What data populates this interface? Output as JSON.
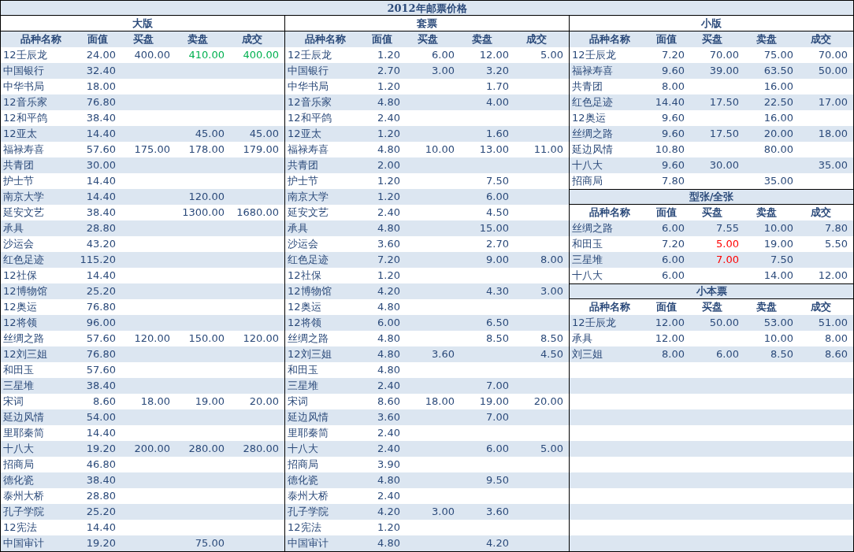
{
  "title": "2012年邮票价格",
  "panels": [
    {
      "sections": [
        {
          "title": "大版",
          "columns": [
            "品种名称",
            "面值",
            "买盘",
            "卖盘",
            "成交"
          ],
          "rows": [
            {
              "name": "12壬辰龙",
              "face_value": "24.00",
              "bid": "400.00",
              "ask": {
                "text": "410.00",
                "color": "#00b050"
              },
              "deal": {
                "text": "400.00",
                "color": "#00b050"
              }
            },
            {
              "name": "中国银行",
              "face_value": "32.40"
            },
            {
              "name": "中华书局",
              "face_value": "18.00"
            },
            {
              "name": "12音乐家",
              "face_value": "76.80"
            },
            {
              "name": "12和平鸽",
              "face_value": "38.40"
            },
            {
              "name": "12亚太",
              "face_value": "14.40",
              "ask": "45.00",
              "deal": "45.00"
            },
            {
              "name": "福禄寿喜",
              "face_value": "57.60",
              "bid": "175.00",
              "ask": "178.00",
              "deal": "179.00"
            },
            {
              "name": "共青团",
              "face_value": "30.00"
            },
            {
              "name": "护士节",
              "face_value": "14.40"
            },
            {
              "name": "南京大学",
              "face_value": "14.40",
              "ask": "120.00"
            },
            {
              "name": "延安文艺",
              "face_value": "38.40",
              "ask": "1300.00",
              "deal": "1680.00"
            },
            {
              "name": "承具",
              "face_value": "28.80"
            },
            {
              "name": "沙运会",
              "face_value": "43.20"
            },
            {
              "name": "红色足迹",
              "face_value": "115.20"
            },
            {
              "name": "12社保",
              "face_value": "14.40"
            },
            {
              "name": "12博物馆",
              "face_value": "25.20"
            },
            {
              "name": "12奥运",
              "face_value": "76.80"
            },
            {
              "name": "12将领",
              "face_value": "96.00"
            },
            {
              "name": "丝绸之路",
              "face_value": "57.60",
              "bid": "120.00",
              "ask": "150.00",
              "deal": "120.00"
            },
            {
              "name": "12刘三姐",
              "face_value": "76.80"
            },
            {
              "name": "和田玉",
              "face_value": "57.60"
            },
            {
              "name": "三星堆",
              "face_value": "38.40"
            },
            {
              "name": "宋词",
              "face_value": "8.60",
              "bid": "18.00",
              "ask": "19.00",
              "deal": "20.00"
            },
            {
              "name": "延边风情",
              "face_value": "54.00"
            },
            {
              "name": "里耶秦简",
              "face_value": "14.40"
            },
            {
              "name": "十八大",
              "face_value": "19.20",
              "bid": "200.00",
              "ask": "280.00",
              "deal": "280.00"
            },
            {
              "name": "招商局",
              "face_value": "46.80"
            },
            {
              "name": "德化瓷",
              "face_value": "38.40"
            },
            {
              "name": "泰州大桥",
              "face_value": "28.80"
            },
            {
              "name": "孔子学院",
              "face_value": "25.20"
            },
            {
              "name": "12宪法",
              "face_value": "14.40"
            },
            {
              "name": "中国审计",
              "face_value": "19.20",
              "ask": "75.00"
            }
          ]
        }
      ]
    },
    {
      "sections": [
        {
          "title": "套票",
          "columns": [
            "品种名称",
            "面值",
            "买盘",
            "卖盘",
            "成交"
          ],
          "rows": [
            {
              "name": "12壬辰龙",
              "face_value": "1.20",
              "bid": "6.00",
              "ask": "12.00",
              "deal": "5.00"
            },
            {
              "name": "中国银行",
              "face_value": "2.70",
              "bid": "3.00",
              "ask": "3.20"
            },
            {
              "name": "中华书局",
              "face_value": "1.20",
              "ask": "1.70"
            },
            {
              "name": "12音乐家",
              "face_value": "4.80",
              "ask": "4.00"
            },
            {
              "name": "12和平鸽",
              "face_value": "2.40"
            },
            {
              "name": "12亚太",
              "face_value": "1.20",
              "ask": "1.60"
            },
            {
              "name": "福禄寿喜",
              "face_value": "4.80",
              "bid": "10.00",
              "ask": "13.00",
              "deal": "11.00"
            },
            {
              "name": "共青团",
              "face_value": "2.00"
            },
            {
              "name": "护士节",
              "face_value": "1.20",
              "ask": "7.50"
            },
            {
              "name": "南京大学",
              "face_value": "1.20",
              "ask": "6.00"
            },
            {
              "name": "延安文艺",
              "face_value": "2.40",
              "ask": "4.50"
            },
            {
              "name": "承具",
              "face_value": "4.80",
              "ask": "15.00"
            },
            {
              "name": "沙运会",
              "face_value": "3.60",
              "ask": "2.70"
            },
            {
              "name": "红色足迹",
              "face_value": "7.20",
              "ask": "9.00",
              "deal": "8.00"
            },
            {
              "name": "12社保",
              "face_value": "1.20"
            },
            {
              "name": "12博物馆",
              "face_value": "4.20",
              "ask": "4.30",
              "deal": "3.00"
            },
            {
              "name": "12奥运",
              "face_value": "4.80"
            },
            {
              "name": "12将领",
              "face_value": "6.00",
              "ask": "6.50"
            },
            {
              "name": "丝绸之路",
              "face_value": "4.80",
              "ask": "8.50",
              "deal": "8.50"
            },
            {
              "name": "12刘三姐",
              "face_value": "4.80",
              "bid": "3.60",
              "deal": "4.50"
            },
            {
              "name": "和田玉",
              "face_value": "4.80"
            },
            {
              "name": "三星堆",
              "face_value": "2.40",
              "ask": "7.00"
            },
            {
              "name": "宋词",
              "face_value": "8.60",
              "bid": "18.00",
              "ask": "19.00",
              "deal": "20.00"
            },
            {
              "name": "延边风情",
              "face_value": "3.60",
              "ask": "7.00"
            },
            {
              "name": "里耶秦简",
              "face_value": "2.40"
            },
            {
              "name": "十八大",
              "face_value": "2.40",
              "ask": "6.00",
              "deal": "5.00"
            },
            {
              "name": "招商局",
              "face_value": "3.90"
            },
            {
              "name": "德化瓷",
              "face_value": "4.80",
              "ask": "9.50"
            },
            {
              "name": "泰州大桥",
              "face_value": "2.40"
            },
            {
              "name": "孔子学院",
              "face_value": "4.20",
              "bid": "3.00",
              "ask": "3.60"
            },
            {
              "name": "12宪法",
              "face_value": "1.20"
            },
            {
              "name": "中国审计",
              "face_value": "4.80",
              "ask": "4.20"
            }
          ]
        }
      ]
    },
    {
      "sections": [
        {
          "title": "小版",
          "columns": [
            "品种名称",
            "面值",
            "买盘",
            "卖盘",
            "成交"
          ],
          "rows": [
            {
              "name": "12壬辰龙",
              "face_value": "7.20",
              "bid": "70.00",
              "ask": "75.00",
              "deal": "70.00"
            },
            {
              "name": "福禄寿喜",
              "face_value": "9.60",
              "bid": "39.00",
              "ask": "63.50",
              "deal": "50.00"
            },
            {
              "name": "共青团",
              "face_value": "8.00",
              "ask": "16.00"
            },
            {
              "name": "红色足迹",
              "face_value": "14.40",
              "bid": "17.50",
              "ask": "22.50",
              "deal": "17.00"
            },
            {
              "name": "12奥运",
              "face_value": "9.60",
              "ask": "16.00"
            },
            {
              "name": "丝绸之路",
              "face_value": "9.60",
              "bid": "17.50",
              "ask": "20.00",
              "deal": "18.00"
            },
            {
              "name": "延边风情",
              "face_value": "10.80",
              "ask": "80.00"
            },
            {
              "name": "十八大",
              "face_value": "9.60",
              "bid": "30.00",
              "deal": "35.00"
            },
            {
              "name": "招商局",
              "face_value": "7.80",
              "ask": "35.00"
            }
          ]
        },
        {
          "title": "型张/全张",
          "columns": [
            "品种名称",
            "面值",
            "买盘",
            "卖盘",
            "成交"
          ],
          "rows": [
            {
              "name": "丝绸之路",
              "face_value": "6.00",
              "bid": "7.55",
              "ask": "10.00",
              "deal": "7.80"
            },
            {
              "name": "和田玉",
              "face_value": "7.20",
              "bid": {
                "text": "5.00",
                "color": "#ff0000"
              },
              "ask": "19.00",
              "deal": "5.50"
            },
            {
              "name": "三星堆",
              "face_value": "6.00",
              "bid": {
                "text": "7.00",
                "color": "#ff0000"
              },
              "ask": "7.50"
            },
            {
              "name": "十八大",
              "face_value": "6.00",
              "ask": "14.00",
              "deal": "12.00"
            }
          ]
        },
        {
          "title": "小本票",
          "columns": [
            "品种名称",
            "面值",
            "买盘",
            "卖盘",
            "成交"
          ],
          "rows": [
            {
              "name": "12壬辰龙",
              "face_value": "12.00",
              "bid": "50.00",
              "ask": "53.00",
              "deal": "51.00"
            },
            {
              "name": "承具",
              "face_value": "12.00",
              "ask": "10.00",
              "deal": "8.00"
            },
            {
              "name": "刘三姐",
              "face_value": "8.00",
              "bid": "6.00",
              "ask": "8.50",
              "deal": "8.60"
            }
          ]
        }
      ]
    }
  ]
}
